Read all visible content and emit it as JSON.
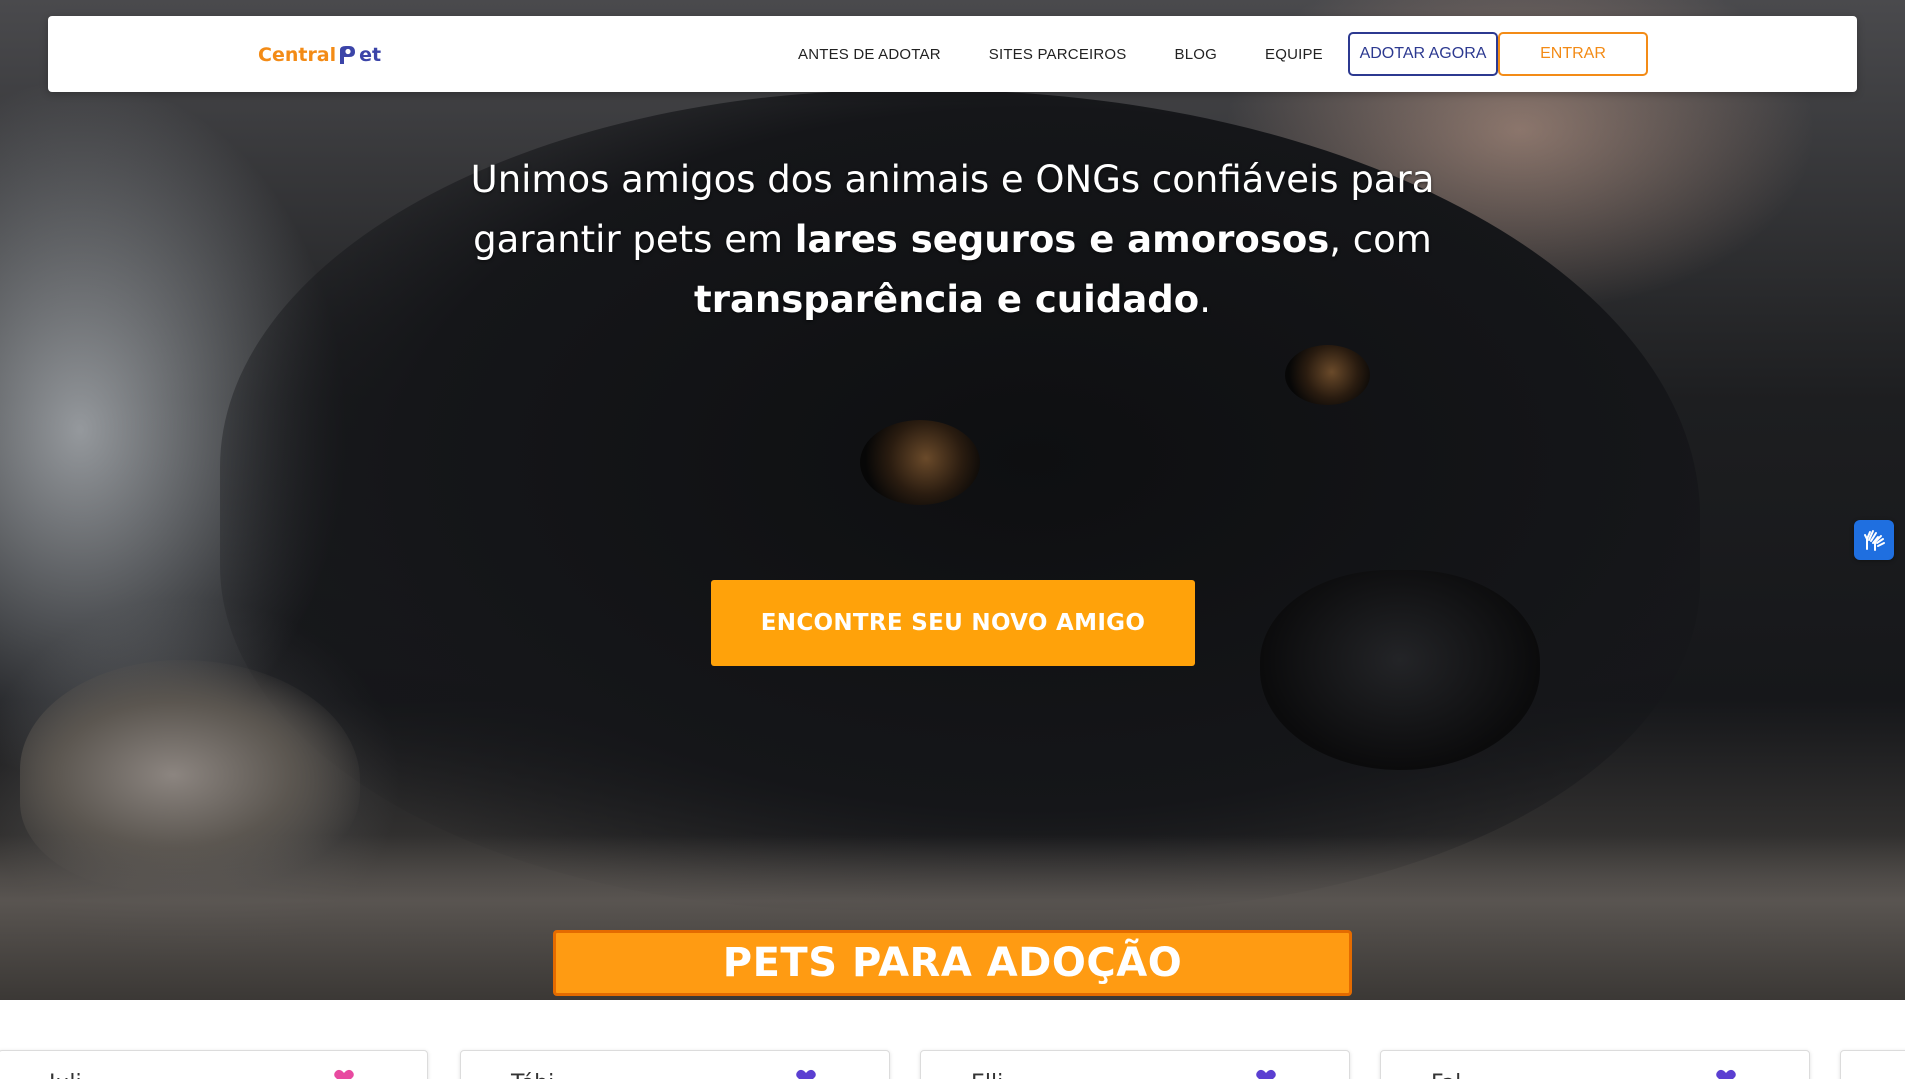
{
  "navbar": {
    "logo": {
      "part1": "Central",
      "part2": "et"
    },
    "links": [
      "ANTES DE ADOTAR",
      "SITES PARCEIROS",
      "BLOG",
      "EQUIPE"
    ],
    "adopt_button": "ADOTAR AGORA",
    "login_button": "ENTRAR"
  },
  "hero": {
    "line1": "Unimos amigos dos animais e ONGs confiáveis para",
    "line2_pre": "garantir pets em ",
    "line2_bold": "lares seguros e amorosos",
    "line2_post": ", com",
    "line3_bold": "transparência e cuidado",
    "line3_post": ".",
    "cta": "ENCONTRE SEU NOVO AMIGO"
  },
  "section": {
    "title": "PETS PARA ADOÇÃO"
  },
  "accessibility": {
    "icon": "sign-language-hands-icon"
  },
  "cards": [
    {
      "name": "Juli",
      "heart_color": "#e84aa0"
    },
    {
      "name": "Tóbi",
      "heart_color": "#5b3fd1"
    },
    {
      "name": "Elli",
      "heart_color": "#5b3fd1"
    },
    {
      "name": "Fal",
      "heart_color": "#5b3fd1"
    }
  ],
  "colors": {
    "brand_orange": "#f38b16",
    "brand_blue": "#2c3990",
    "cta_orange": "#ffa20a"
  }
}
